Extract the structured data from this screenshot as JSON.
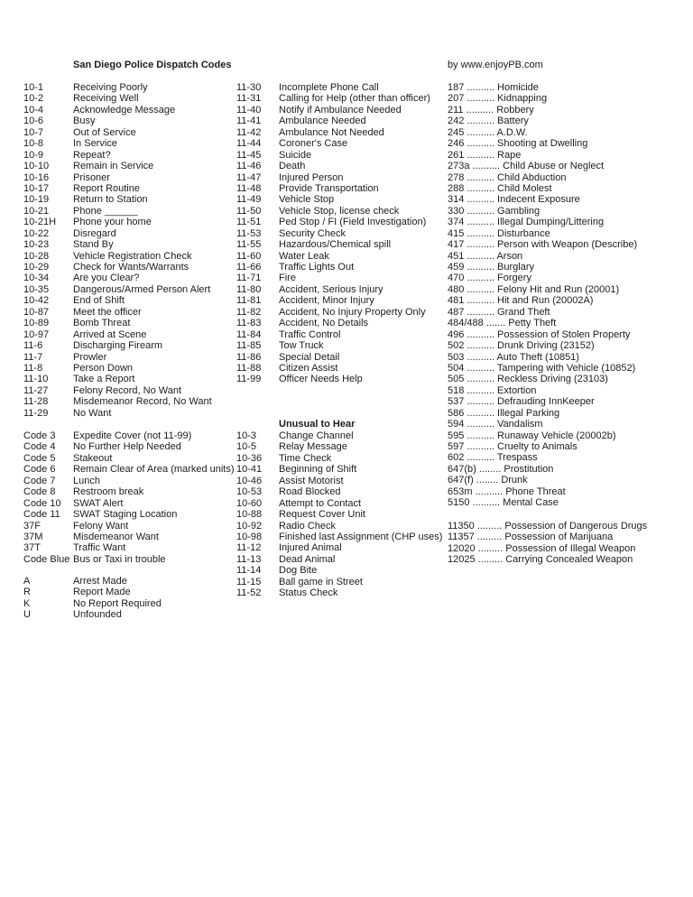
{
  "header": {
    "title": "San Diego Police Dispatch Codes",
    "credit": "by www.enjoyPB.com"
  },
  "ten_codes": [
    {
      "code": "10-1",
      "desc": "Receiving Poorly"
    },
    {
      "code": "10-2",
      "desc": "Receiving Well"
    },
    {
      "code": "10-4",
      "desc": "Acknowledge Message"
    },
    {
      "code": "10-6",
      "desc": "Busy"
    },
    {
      "code": "10-7",
      "desc": "Out of Service"
    },
    {
      "code": "10-8",
      "desc": "In Service"
    },
    {
      "code": "10-9",
      "desc": "Repeat?"
    },
    {
      "code": "10-10",
      "desc": "Remain in Service"
    },
    {
      "code": "10-16",
      "desc": "Prisoner"
    },
    {
      "code": "10-17",
      "desc": "Report Routine"
    },
    {
      "code": "10-19",
      "desc": "Return to Station"
    },
    {
      "code": "10-21",
      "desc": "Phone ______"
    },
    {
      "code": "10-21H",
      "desc": "Phone your home"
    },
    {
      "code": "10-22",
      "desc": "Disregard"
    },
    {
      "code": "10-23",
      "desc": "Stand  By"
    },
    {
      "code": "10-28",
      "desc": "Vehicle Registration Check"
    },
    {
      "code": "10-29",
      "desc": "Check for Wants/Warrants"
    },
    {
      "code": "10-34",
      "desc": "Are you Clear?"
    },
    {
      "code": "10-35",
      "desc": "Dangerous/Armed Person Alert"
    },
    {
      "code": "10-42",
      "desc": "End of Shift"
    },
    {
      "code": "10-87",
      "desc": "Meet the officer"
    },
    {
      "code": "10-89",
      "desc": "Bomb Threat"
    },
    {
      "code": "10-97",
      "desc": "Arrived at Scene"
    },
    {
      "code": "11-6",
      "desc": "Discharging Firearm"
    },
    {
      "code": "11-7",
      "desc": "Prowler"
    },
    {
      "code": "11-8",
      "desc": "Person Down"
    },
    {
      "code": "11-10",
      "desc": "Take a Report"
    },
    {
      "code": "11-27",
      "desc": "Felony Record, No Want"
    },
    {
      "code": "11-28",
      "desc": "Misdemeanor Record, No Want"
    },
    {
      "code": "11-29",
      "desc": "No Want"
    }
  ],
  "special_codes": [
    {
      "code": "Code 3",
      "desc": "Expedite Cover (not 11-99)"
    },
    {
      "code": "Code 4",
      "desc": "No Further Help Needed"
    },
    {
      "code": "Code 5",
      "desc": "Stakeout"
    },
    {
      "code": "Code 6",
      "desc": "Remain Clear of Area (marked units)"
    },
    {
      "code": "Code 7",
      "desc": "Lunch"
    },
    {
      "code": "Code 8",
      "desc": "Restroom break"
    },
    {
      "code": "Code 10",
      "desc": "SWAT Alert"
    },
    {
      "code": "Code 11",
      "desc": "SWAT Staging Location"
    },
    {
      "code": "37F",
      "desc": "Felony Want"
    },
    {
      "code": "37M",
      "desc": "Misdemeanor Want"
    },
    {
      "code": "37T",
      "desc": "Traffic Want"
    },
    {
      "code": "Code Blue",
      "desc": "Bus or Taxi in trouble"
    }
  ],
  "disposition_codes": [
    {
      "code": "A",
      "desc": "Arrest Made"
    },
    {
      "code": "R",
      "desc": "Report Made"
    },
    {
      "code": "K",
      "desc": "No Report Required"
    },
    {
      "code": "U",
      "desc": "Unfounded"
    }
  ],
  "eleven_codes": [
    {
      "code": "11-30",
      "desc": "Incomplete Phone Call"
    },
    {
      "code": "11-31",
      "desc": "Calling for Help (other than officer)"
    },
    {
      "code": "11-40",
      "desc": "Notify if Ambulance Needed"
    },
    {
      "code": "11-41",
      "desc": "Ambulance Needed"
    },
    {
      "code": "11-42",
      "desc": "Ambulance Not Needed"
    },
    {
      "code": "11-44",
      "desc": "Coroner's Case"
    },
    {
      "code": "11-45",
      "desc": "Suicide"
    },
    {
      "code": "11-46",
      "desc": "Death"
    },
    {
      "code": "11-47",
      "desc": "Injured Person"
    },
    {
      "code": "11-48",
      "desc": "Provide Transportation"
    },
    {
      "code": "11-49",
      "desc": "Vehicle Stop"
    },
    {
      "code": "11-50",
      "desc": "Vehicle Stop, license check"
    },
    {
      "code": "11-51",
      "desc": "Ped Stop / FI (Field Investigation)"
    },
    {
      "code": "11-53",
      "desc": "Security Check"
    },
    {
      "code": "11-55",
      "desc": "Hazardous/Chemical spill"
    },
    {
      "code": "11-60",
      "desc": "Water Leak"
    },
    {
      "code": "11-66",
      "desc": "Traffic Lights Out"
    },
    {
      "code": "11-71",
      "desc": "Fire"
    },
    {
      "code": "11-80",
      "desc": "Accident, Serious Injury"
    },
    {
      "code": "11-81",
      "desc": "Accident, Minor Injury"
    },
    {
      "code": "11-82",
      "desc": "Accident, No Injury Property Only"
    },
    {
      "code": "11-83",
      "desc": "Accident, No Details"
    },
    {
      "code": "11-84",
      "desc": "Traffic Control"
    },
    {
      "code": "11-85",
      "desc": "Tow Truck"
    },
    {
      "code": "11-86",
      "desc": "Special Detail"
    },
    {
      "code": "11-88",
      "desc": "Citizen Assist"
    },
    {
      "code": "11-99",
      "desc": "Officer Needs Help"
    }
  ],
  "unusual": {
    "heading": "Unusual to Hear",
    "items": [
      {
        "code": "10-3",
        "desc": "Change Channel"
      },
      {
        "code": "10-5",
        "desc": "Relay Message"
      },
      {
        "code": "10-36",
        "desc": "Time Check"
      },
      {
        "code": "10-41",
        "desc": "Beginning of Shift"
      },
      {
        "code": "10-46",
        "desc": "Assist Motorist"
      },
      {
        "code": "10-53",
        "desc": "Road Blocked"
      },
      {
        "code": "10-60",
        "desc": "Attempt to Contact"
      },
      {
        "code": "10-88",
        "desc": "Request Cover Unit"
      },
      {
        "code": "10-92",
        "desc": "Radio Check"
      },
      {
        "code": "10-98",
        "desc": "Finished last Assignment (CHP uses)"
      },
      {
        "code": "11-12",
        "desc": "Injured Animal"
      },
      {
        "code": "11-13",
        "desc": "Dead Animal"
      },
      {
        "code": "11-14",
        "desc": "Dog Bite"
      },
      {
        "code": "11-15",
        "desc": "Ball game in Street"
      },
      {
        "code": "11-52",
        "desc": "Status Check"
      }
    ]
  },
  "penal_codes": [
    {
      "code": "187",
      "leader": "..........",
      "desc": "Homicide"
    },
    {
      "code": "207",
      "leader": "..........",
      "desc": "Kidnapping"
    },
    {
      "code": "211",
      "leader": "..........",
      "desc": "Robbery"
    },
    {
      "code": "242",
      "leader": "..........",
      "desc": "Battery"
    },
    {
      "code": "245",
      "leader": "..........",
      "desc": "A.D.W."
    },
    {
      "code": "246",
      "leader": "..........",
      "desc": "Shooting at Dwelling"
    },
    {
      "code": "261",
      "leader": "..........",
      "desc": "Rape"
    },
    {
      "code": "273a",
      "leader": "..........",
      "desc": "Child Abuse or Neglect"
    },
    {
      "code": "278",
      "leader": "..........",
      "desc": "Child Abduction"
    },
    {
      "code": "288",
      "leader": "..........",
      "desc": "Child Molest"
    },
    {
      "code": "314",
      "leader": "..........",
      "desc": "Indecent Exposure"
    },
    {
      "code": "330",
      "leader": "..........",
      "desc": "Gambling"
    },
    {
      "code": "374",
      "leader": "..........",
      "desc": "Illegal Dumping/Littering"
    },
    {
      "code": "415",
      "leader": "..........",
      "desc": "Disturbance"
    },
    {
      "code": "417",
      "leader": "..........",
      "desc": "Person with Weapon (Describe)"
    },
    {
      "code": "451",
      "leader": "..........",
      "desc": "Arson"
    },
    {
      "code": "459",
      "leader": "..........",
      "desc": "Burglary"
    },
    {
      "code": "470",
      "leader": "..........",
      "desc": "Forgery"
    },
    {
      "code": "480",
      "leader": "..........",
      "desc": "Felony Hit and Run (20001)"
    },
    {
      "code": "481",
      "leader": "..........",
      "desc": "Hit and Run (20002A)"
    },
    {
      "code": "487",
      "leader": "..........",
      "desc": "Grand Theft"
    },
    {
      "code": "484/488",
      "leader": ".......",
      "desc": "Petty Theft"
    },
    {
      "code": "496",
      "leader": "..........",
      "desc": "Possession of Stolen Property"
    },
    {
      "code": "502",
      "leader": "..........",
      "desc": "Drunk Driving (23152)"
    },
    {
      "code": "503",
      "leader": "..........",
      "desc": "Auto Theft (10851)"
    },
    {
      "code": "504",
      "leader": "..........",
      "desc": "Tampering with Vehicle (10852)"
    },
    {
      "code": "505",
      "leader": "..........",
      "desc": "Reckless Driving (23103)"
    },
    {
      "code": "518",
      "leader": "..........",
      "desc": "Extortion"
    },
    {
      "code": "537",
      "leader": "..........",
      "desc": "Defrauding InnKeeper"
    },
    {
      "code": "586",
      "leader": "..........",
      "desc": "Illegal Parking"
    },
    {
      "code": "594",
      "leader": "..........",
      "desc": "Vandalism"
    },
    {
      "code": "595",
      "leader": "..........",
      "desc": "Runaway Vehicle (20002b)"
    },
    {
      "code": "597",
      "leader": "..........",
      "desc": "Cruelty to Animals"
    },
    {
      "code": "602",
      "leader": "..........",
      "desc": "Trespass"
    },
    {
      "code": "647(b)",
      "leader": "........",
      "desc": "Prostitution"
    },
    {
      "code": "647(f)",
      "leader": "........",
      "desc": "Drunk"
    },
    {
      "code": "653m",
      "leader": "..........",
      "desc": "Phone Threat"
    },
    {
      "code": "5150",
      "leader": "..........",
      "desc": "Mental Case"
    }
  ],
  "other_codes": [
    {
      "code": "11350",
      "leader": ".........",
      "desc": "Possession of Dangerous Drugs"
    },
    {
      "code": "11357",
      "leader": ".........",
      "desc": "Possession of Marijuana"
    },
    {
      "code": "12020",
      "leader": ".........",
      "desc": "Possession of Illegal Weapon"
    },
    {
      "code": "12025",
      "leader": ".........",
      "desc": "Carrying Concealed Weapon"
    }
  ]
}
